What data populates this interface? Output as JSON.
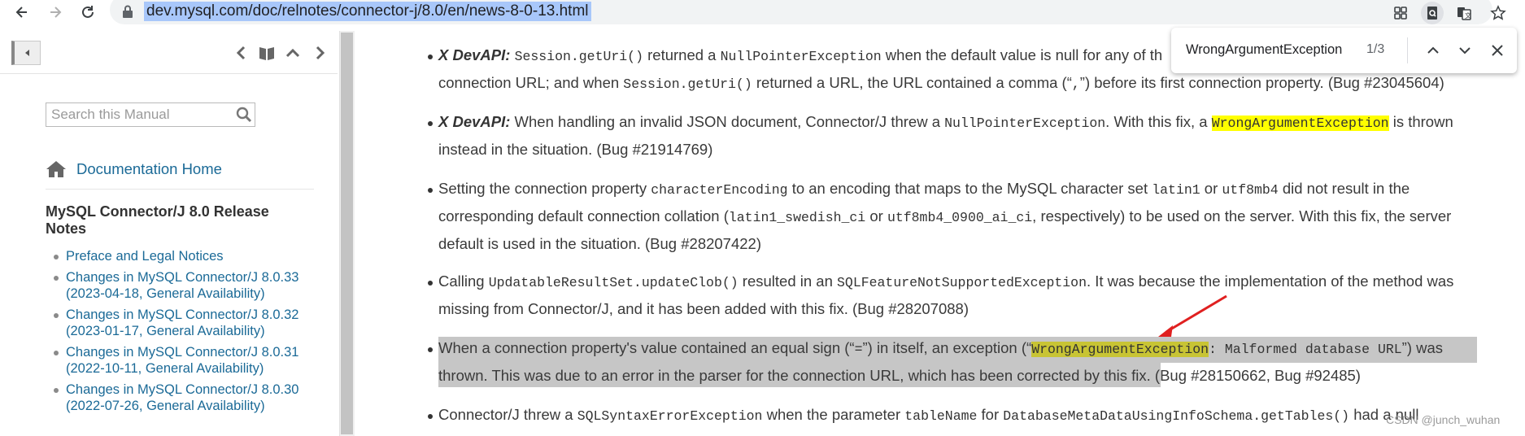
{
  "browser": {
    "url": "dev.mysql.com/doc/relnotes/connector-j/8.0/en/news-8-0-13.html",
    "back_icon": "arrow-left-icon",
    "forward_icon": "arrow-right-icon",
    "reload_icon": "reload-icon"
  },
  "sidebar": {
    "search_placeholder": "Search this Manual",
    "doc_home_label": "Documentation Home",
    "release_title": "MySQL Connector/J 8.0 Release Notes",
    "toc": [
      "Preface and Legal Notices",
      "Changes in MySQL Connector/J 8.0.33 (2023-04-18, General Availability)",
      "Changes in MySQL Connector/J 8.0.32 (2023-01-17, General Availability)",
      "Changes in MySQL Connector/J 8.0.31 (2022-10-11, General Availability)",
      "Changes in MySQL Connector/J 8.0.30 (2022-07-26, General Availability)"
    ]
  },
  "findbar": {
    "query": "WrongArgumentException",
    "count": "1/3"
  },
  "content": {
    "items": [
      {
        "api": "X DevAPI:",
        "t1": " ",
        "c1": "Session.getUri()",
        "t2": " returned a ",
        "c2": "NullPointerException",
        "t3": " when the default value is null for any of th",
        "line2a": "connection URL; and when ",
        "c3": "Session.getUri()",
        "line2b": " returned a URL, the URL contained a comma (“",
        "c4": ",",
        "line2c": "”) before its first connection property. (Bug #23045604)"
      },
      {
        "api": "X DevAPI:",
        "t1": " When handling an invalid JSON document, Connector/J threw a ",
        "c1": "NullPointerException",
        "t2": ". With this fix, a ",
        "hl": "WrongArgumentException",
        "t3": " is thrown",
        "line2": "instead in the situation. (Bug #21914769)"
      },
      {
        "t1": "Setting the connection property ",
        "c1": "characterEncoding",
        "t2": " to an encoding that maps to the MySQL character set ",
        "c2": "latin1",
        "t3": " or ",
        "c3": "utf8mb4",
        "t4": " did not result in the",
        "l2a": "corresponding default connection collation (",
        "c4": "latin1_swedish_ci",
        "l2b": " or ",
        "c5": "utf8mb4_0900_ai_ci",
        "l2c": ", respectively) to be used on the server. With this fix, the server",
        "line3": "default is used in the situation. (Bug #28207422)"
      },
      {
        "t1": "Calling ",
        "c1": "UpdatableResultSet.updateClob()",
        "t2": " resulted in an ",
        "c2": "SQLFeatureNotSupportedException",
        "t3": ". It was because the implementation of the method was",
        "line2": "missing from Connector/J, and it has been added with this fix. (Bug #28207088)"
      },
      {
        "t1": "When a connection property's value contained an equal sign (“",
        "c1": "=",
        "t2": "”) in itself, an exception (“",
        "hl": "WrongArgumentException",
        "c2": ": Malformed database URL",
        "t3": "”) was",
        "line2a": "thrown. This was due to an error in the parser for the connection URL, which has been corrected by this fix.",
        "line2b": " (Bug #28150662, Bug #92485)"
      },
      {
        "t1": "Connector/J threw a ",
        "c1": "SQLSyntaxErrorException",
        "t2": " when the parameter ",
        "c2": "tableName",
        "t3": " for ",
        "c3": "DatabaseMetaDataUsingInfoSchema.getTables()",
        "t4": " had a null"
      }
    ]
  },
  "watermark": "CSDN @junch_wuhan",
  "colors": {
    "link": "#1b6a97",
    "find_highlight": "#ffff00",
    "active_highlight": "#c8c434",
    "selection": "#c6c6c6",
    "arrow": "#e02020"
  }
}
